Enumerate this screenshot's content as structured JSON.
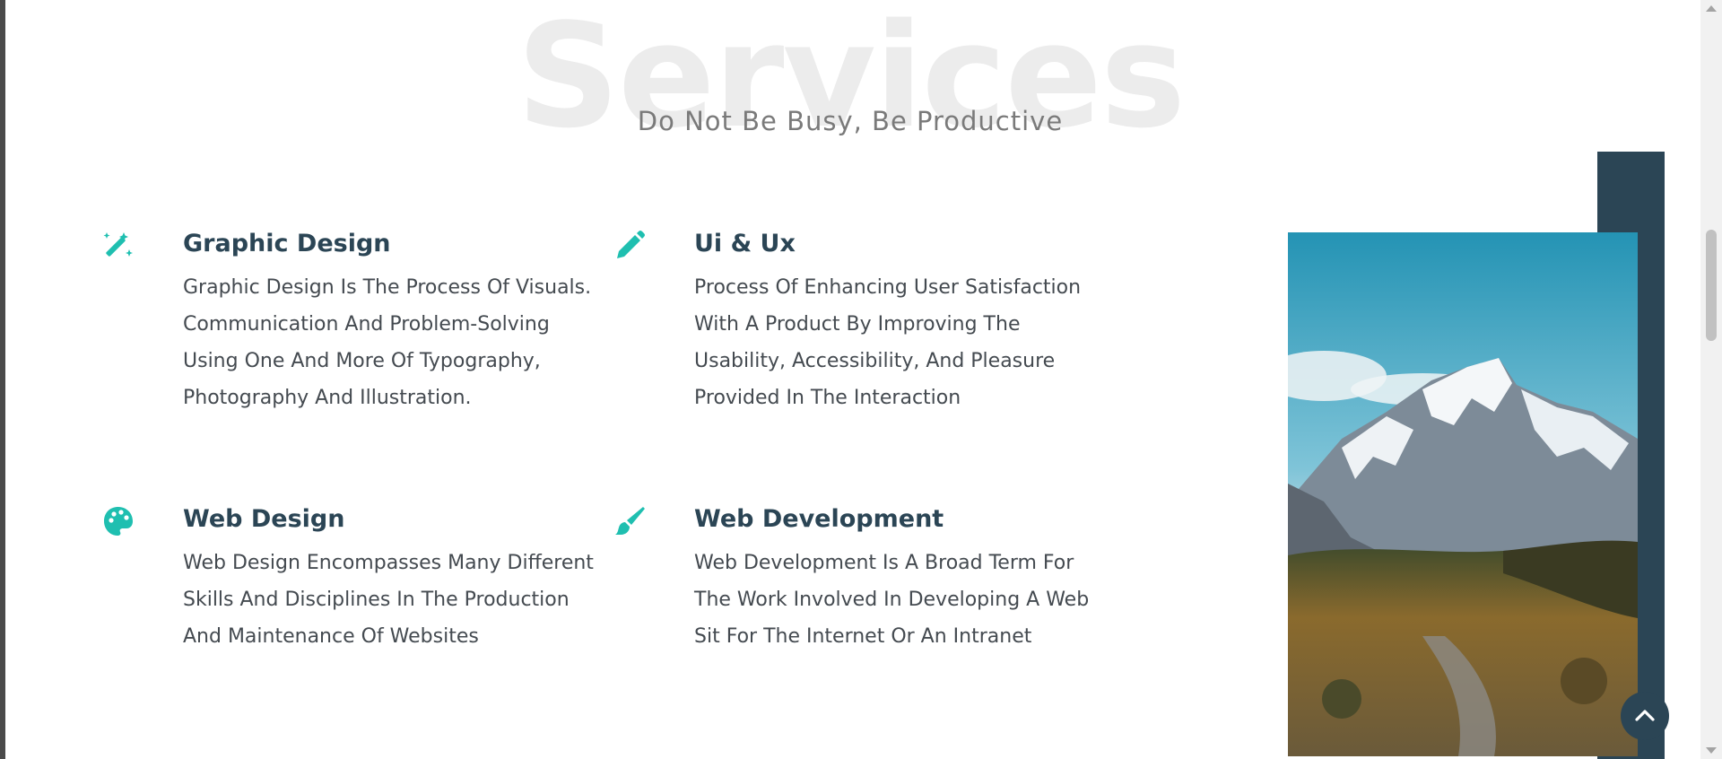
{
  "section": {
    "heading_bg": "Services",
    "subtitle": "Do Not Be Busy, Be Productive"
  },
  "services": [
    {
      "title": "Graphic Design",
      "icon": "magic-wand-icon",
      "description": "Graphic Design Is The Process Of Visuals. Communication And Problem-Solving Using One And More Of Typography, Photography And Illustration."
    },
    {
      "title": "Ui & Ux",
      "icon": "pencil-icon",
      "description": "Process Of Enhancing User Satisfaction With A Product By Improving The Usability, Accessibility, And Pleasure Provided In The Interaction"
    },
    {
      "title": "Web Design",
      "icon": "palette-icon",
      "description": "Web Design Encompasses Many Different Skills And Disciplines In The Production And Maintenance Of Websites"
    },
    {
      "title": "Web Development",
      "icon": "paintbrush-icon",
      "description": "Web Development Is A Broad Term For The Work Involved In Developing A Web Sit For The Internet Or An Intranet"
    }
  ],
  "image": {
    "subject": "mountain-landscape-image"
  },
  "scroll_top": {
    "icon": "chevron-up-icon"
  },
  "colors": {
    "accent": "#1fbfb0",
    "dark": "#2b4555",
    "heading_bg": "#ececec",
    "text": "#444a50"
  }
}
